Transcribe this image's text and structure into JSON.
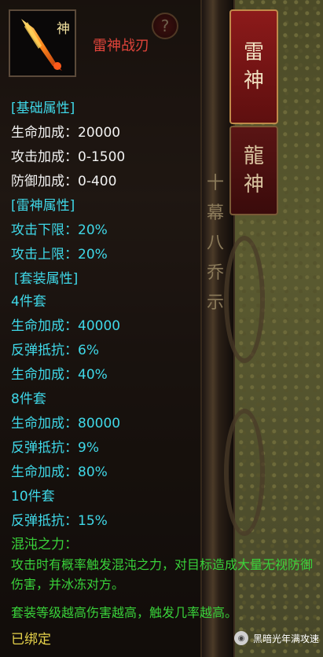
{
  "item": {
    "name": "雷神战刃",
    "icon_glyph": "神"
  },
  "tabs": [
    {
      "label_line1": "雷",
      "label_line2": "神"
    },
    {
      "label_line1": "龍",
      "label_line2": "神"
    }
  ],
  "help_label": "?",
  "pillar_runes": [
    "十",
    "幕",
    "八",
    "乔",
    "示"
  ],
  "base_section": {
    "header": "[基础属性]",
    "lines": [
      "生命加成：20000",
      "攻击加成：0-1500",
      "防御加成：0-400"
    ]
  },
  "thunder_section": {
    "header": "[雷神属性]",
    "lines": [
      "攻击下限：20%",
      "攻击上限：20%"
    ]
  },
  "set_section": {
    "header": "[套装属性]",
    "tier4": {
      "title": "4件套",
      "lines": [
        "生命加成：40000",
        "反弹抵抗：6%",
        "生命加成：40%"
      ]
    },
    "tier8": {
      "title": "8件套",
      "lines": [
        "生命加成：80000",
        "反弹抵抗：9%",
        "生命加成：80%"
      ]
    },
    "tier10": {
      "title": "10件套",
      "lines": [
        "反弹抵抗：15%"
      ]
    }
  },
  "chaos": {
    "header": "混沌之力：",
    "desc1": "攻击时有概率触发混沌之力，对目标造成大量无视防御伤害，并冰冻对方。",
    "desc2": "套装等级越高伤害越高，触发几率越高。"
  },
  "bound": "已绑定",
  "watermark": "黑暗光年满攻速",
  "colors": {
    "name": "#e0443a",
    "cyan": "#3fd8e8",
    "green": "#39d23a",
    "yellow": "#e6d24a"
  }
}
